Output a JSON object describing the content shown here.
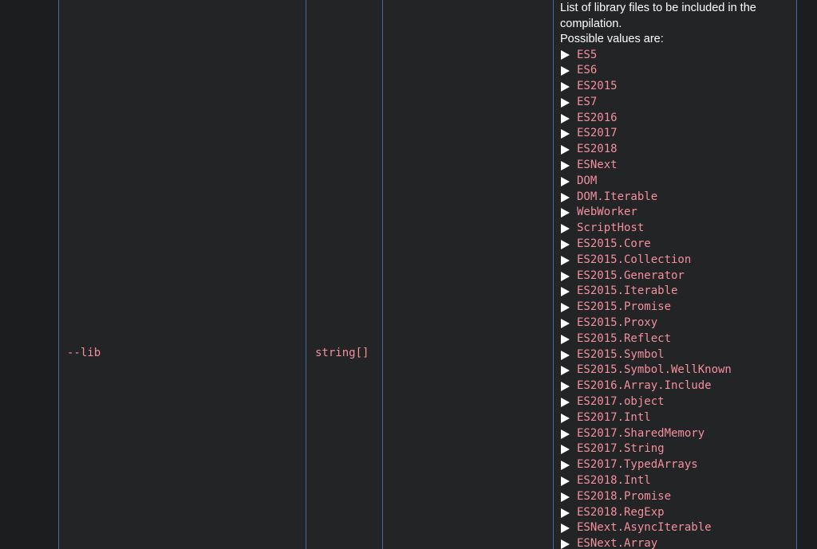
{
  "table": {
    "flag": "--lib",
    "type": "string[]",
    "default": "",
    "description": {
      "intro": "List of library files to be included in the compilation.",
      "possible_values_label": "Possible values are:",
      "values": [
        "ES5",
        "ES6",
        "ES2015",
        "ES7",
        "ES2016",
        "ES2017",
        "ES2018",
        "ESNext",
        "DOM",
        "DOM.Iterable",
        "WebWorker",
        "ScriptHost",
        "ES2015.Core",
        "ES2015.Collection",
        "ES2015.Generator",
        "ES2015.Iterable",
        "ES2015.Promise",
        "ES2015.Proxy",
        "ES2015.Reflect",
        "ES2015.Symbol",
        "ES2015.Symbol.WellKnown",
        "ES2016.Array.Include",
        "ES2017.object",
        "ES2017.Intl",
        "ES2017.SharedMemory",
        "ES2017.String",
        "ES2017.TypedArrays",
        "ES2018.Intl",
        "ES2018.Promise",
        "ES2018.RegExp",
        "ESNext.AsyncIterable",
        "ESNext.Array"
      ]
    }
  },
  "colors": {
    "page_background": "#1c1d1e",
    "table_background": "#222426",
    "border": "#3c6aa6",
    "code_text": "#f48f9d",
    "body_text": "#ffffff"
  }
}
